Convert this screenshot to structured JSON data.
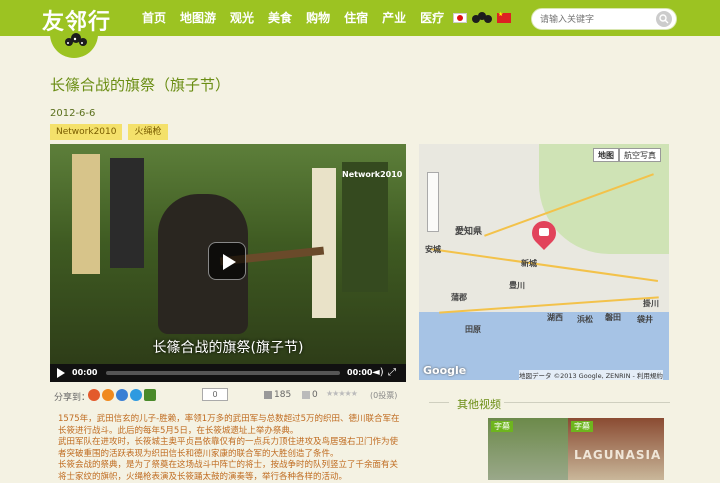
{
  "header": {
    "logo": "友邻行",
    "nav": [
      "首页",
      "地图游",
      "观光",
      "美食",
      "购物",
      "住宿",
      "产业",
      "医疗"
    ],
    "search_placeholder": "请输入关键字"
  },
  "article": {
    "title": "长篠合战的旗祭（旗子节）",
    "date": "2012-6-6",
    "tags": [
      "Network2010",
      "火绳枪"
    ]
  },
  "video": {
    "watermark": "Network2010",
    "caption": "长篠合战的旗祭(旗子节)",
    "time_current": "00:00",
    "time_total": "00:00"
  },
  "share": {
    "label": "分享到：",
    "count": "0",
    "plays": "185",
    "comments": "0",
    "votes": "(0投票)"
  },
  "body": [
    "1575年，武田信玄的儿子-胜赖，率领1万多的武田军与总数超过5万的织田、德川联合军在长筱进行战斗。此后的每年5月5日，在长筱城遗址上举办祭典。",
    "武田军队在进攻时，长筱城主奥平贞昌依靠仅有的一点兵力顶住进攻及鸟居强右卫门作为使者突破重围的活跃表现为织田信长和德川家康的联合军的大胜创造了条件。",
    "长筱会战的祭典，是为了祭奠在这场战斗中阵亡的将士，按战争时的队列竖立了千余面有关将士家纹的旗帜，火绳枪表演及长筱踊太鼓的演奏等，举行各种各样的活动。"
  ],
  "map": {
    "btn_map": "地图",
    "btn_sat": "航空写真",
    "cities": [
      "愛知県",
      "新城",
      "豊川",
      "蒲郡",
      "田原",
      "湖西",
      "浜松",
      "掛川",
      "磐田",
      "袋井",
      "安城"
    ],
    "copyright": "地図データ ©2013 Google, ZENRIN - 利用規約",
    "brand": "Google"
  },
  "other": {
    "title": "其他视频",
    "badge": "字幕",
    "thumb2_text": "LAGUNASIA"
  }
}
